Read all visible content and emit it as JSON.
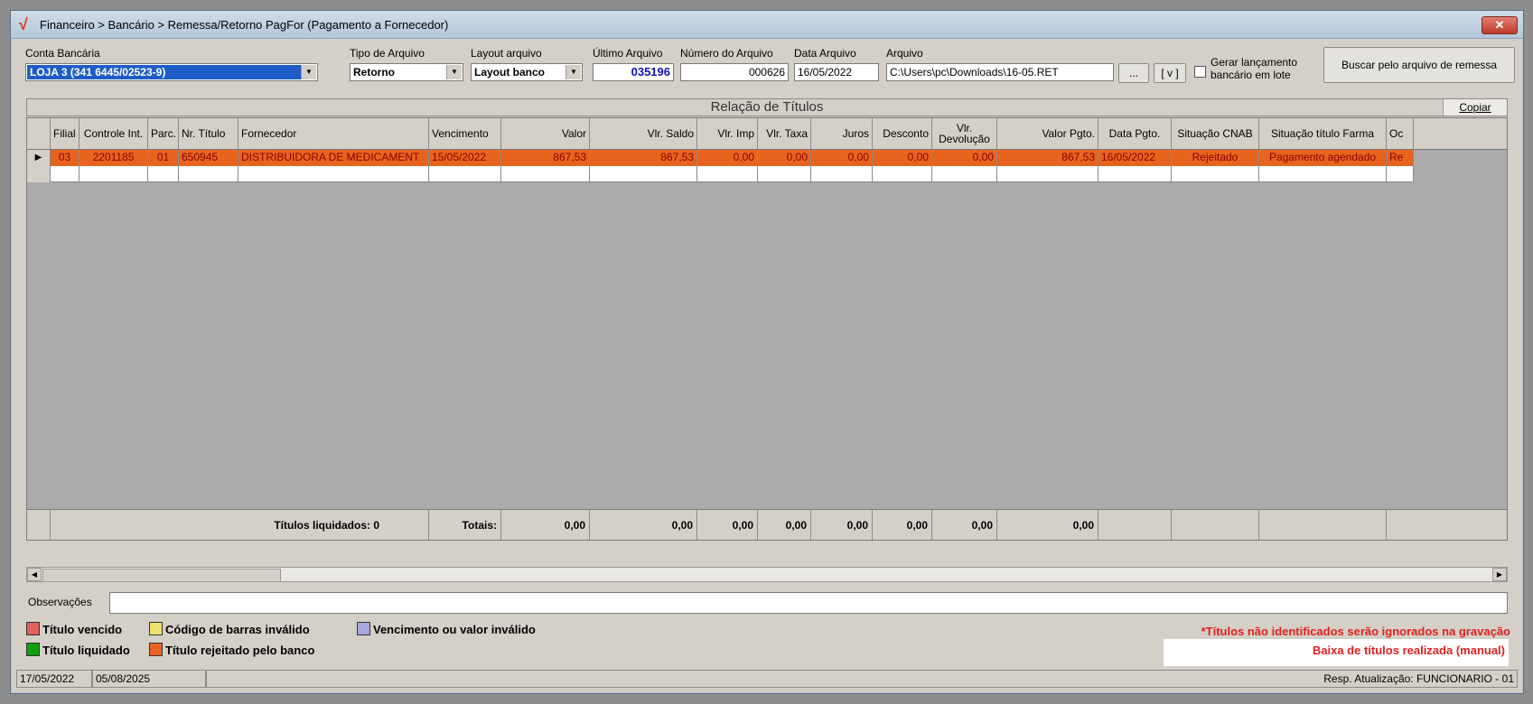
{
  "window": {
    "title": "Financeiro > Bancário > Remessa/Retorno PagFor (Pagamento  a Fornecedor)",
    "close_label": "✕"
  },
  "form": {
    "conta_bancaria_label": "Conta Bancária",
    "conta_bancaria_value": "LOJA 3 (341 6445/02523-9)",
    "tipo_arquivo_label": "Tipo de Arquivo",
    "tipo_arquivo_value": "Retorno",
    "layout_arquivo_label": "Layout arquivo",
    "layout_arquivo_value": "Layout banco",
    "ultimo_arquivo_label": "Último Arquivo",
    "ultimo_arquivo_value": "035196",
    "numero_arquivo_label": "Número do Arquivo",
    "numero_arquivo_value": "000626",
    "data_arquivo_label": "Data Arquivo",
    "data_arquivo_value": "16/05/2022",
    "arquivo_label": "Arquivo",
    "arquivo_value": "C:\\Users\\pc\\Downloads\\16-05.RET",
    "browse_label": "...",
    "v_label": "[ v ]",
    "gerar_label_1": "Gerar lançamento",
    "gerar_label_2": "bancário em lote",
    "buscar_label": "Buscar pelo arquivo de remessa"
  },
  "grid": {
    "title": "Relação de Títulos",
    "copy_label": "Copiar",
    "columns": [
      "Filial",
      "Controle Int.",
      "Parc.",
      "Nr. Título",
      "Fornecedor",
      "Vencimento",
      "Valor",
      "Vlr. Saldo",
      "Vlr. Imp",
      "Vlr. Taxa",
      "Juros",
      "Desconto",
      "Vlr. Devolução",
      "Valor Pgto.",
      "Data Pgto.",
      "Situação CNAB",
      "Situação título Farma",
      "Oc"
    ],
    "col_vlr_devolucao_1": "Vlr.",
    "col_vlr_devolucao_2": "Devolução",
    "rows": [
      [
        "03",
        "2201185",
        "01",
        "650945",
        "DISTRIBUIDORA DE MEDICAMENT",
        "15/05/2022",
        "867,53",
        "867,53",
        "0,00",
        "0,00",
        "0,00",
        "0,00",
        "0,00",
        "867,53",
        "16/05/2022",
        "Rejeitado",
        "Pagamento agendado",
        "Re"
      ]
    ],
    "footer": {
      "titulos_liquidados": "Títulos liquidados: 0",
      "totais": "Totais:",
      "valor": "0,00",
      "vlr_saldo": "0,00",
      "vlr_imp": "0,00",
      "vlr_taxa": "0,00",
      "juros": "0,00",
      "desconto": "0,00",
      "vlr_devolucao": "0,00",
      "valor_pgto": "0,00"
    }
  },
  "observacoes_label": "Observações",
  "legend": {
    "vencido": "Título vencido",
    "codigo_barras": "Código de barras inválido",
    "vencimento_valor": "Vencimento ou valor inválido",
    "liquidado": "Título liquidado",
    "rejeitado": "Título rejeitado pelo banco",
    "note_ignorados": "*Títulos não identificados serão ignorados na gravação",
    "note_baixa": "Baixa de títulos realizada (manual)",
    "colors": {
      "vencido": "#e06060",
      "codigo_barras": "#f0e070",
      "vencimento_valor": "#a8a8e0",
      "liquidado": "#10a010",
      "rejeitado": "#e8641e"
    }
  },
  "status": {
    "date1": "17/05/2022",
    "date2": "05/08/2025",
    "resp": "Resp. Atualização: FUNCIONARIO - 01"
  }
}
